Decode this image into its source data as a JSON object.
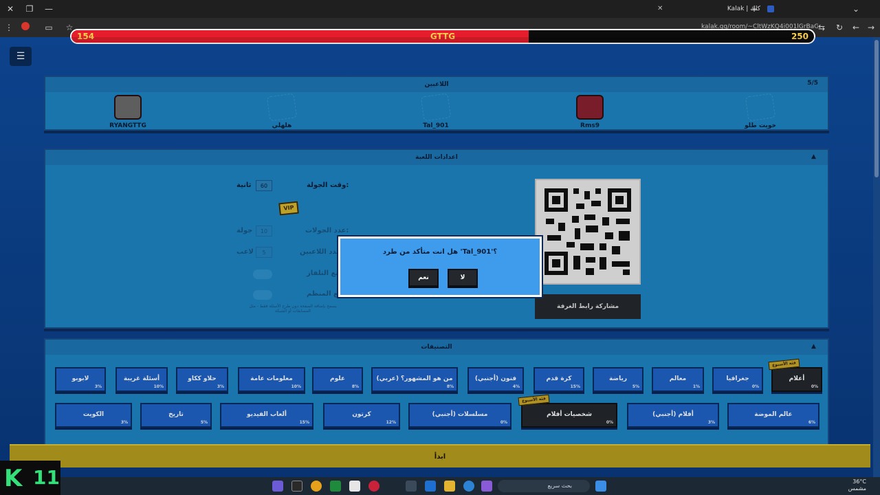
{
  "browser": {
    "tab_title": "Kalak | كلك",
    "url": "kalak.gg/room/~CltWzKQ4i001lGrBaGa-v3e"
  },
  "progress": {
    "left_value": "154",
    "center_label": "GTTG",
    "right_value": "250",
    "fill_fraction": 0.616
  },
  "players": {
    "title": "اللاعبين",
    "count": "5/5",
    "list": [
      {
        "name": "RYANGTTG",
        "has_avatar": true
      },
      {
        "name": "هلهلي",
        "has_avatar": false
      },
      {
        "name": "Tal_901",
        "has_avatar": false
      },
      {
        "name": "Rms9",
        "has_avatar": true
      },
      {
        "name": "خويت طلو",
        "has_avatar": false
      }
    ]
  },
  "settings": {
    "title": "اعدادات اللعبة",
    "round_time_label": "وقت الجولة:",
    "round_time_value": "60",
    "round_time_unit": "ثانية",
    "vip_label": "VIP",
    "rounds_label": "عدد الجولات:",
    "rounds_value": "10",
    "rounds_unit": "جولة",
    "players_label": "عدد اللاعبين:",
    "players_value": "5",
    "players_unit": "لاعب",
    "tv_mode_label": "ضع التلفاز:",
    "organizer_mode_label": "ضع المنظم:",
    "note": "يسمح بإضافة الصفحة دون طرح الأسئلة فقط - مثل المسابقات أو الشبكة",
    "share_button": "مشاركة رابط الغرفة"
  },
  "categories": {
    "title": "التصنيفات",
    "row1": [
      {
        "label": "لابوبو",
        "pct": "3%"
      },
      {
        "label": "أسئلة غريبة",
        "pct": "10%"
      },
      {
        "label": "حلاو ككاو",
        "pct": "3%"
      },
      {
        "label": "معلومات عامة",
        "pct": "10%"
      },
      {
        "label": "علوم",
        "pct": "8%"
      },
      {
        "label": "من هو المشهور؟ (عربي)",
        "pct": "8%"
      },
      {
        "label": "فنون (أجنبي)",
        "pct": "4%"
      },
      {
        "label": "كرة قدم",
        "pct": "15%"
      },
      {
        "label": "رياضة",
        "pct": "5%"
      },
      {
        "label": "معالم",
        "pct": "1%"
      },
      {
        "label": "جغرافيا",
        "pct": "0%"
      },
      {
        "label": "أعلام",
        "pct": "0%",
        "badge": "فئة الأسبوع"
      }
    ],
    "row2": [
      {
        "label": "الكويت",
        "pct": "3%"
      },
      {
        "label": "تاريخ",
        "pct": "5%"
      },
      {
        "label": "ألعاب الفيديو",
        "pct": "15%"
      },
      {
        "label": "كرتون",
        "pct": "12%"
      },
      {
        "label": "مسلسلات (أجنبي)",
        "pct": "0%"
      },
      {
        "label": "شخصيات أفلام",
        "pct": "0%",
        "badge": "فئة الأسبوع"
      },
      {
        "label": "أفلام (أجنبي)",
        "pct": "3%"
      },
      {
        "label": "عالم الموضة",
        "pct": "6%"
      }
    ]
  },
  "bottom_bar": {
    "label": "ابدأ"
  },
  "dialog": {
    "message": "هل انت متأكد من طرد 'Tal_901'؟",
    "yes_label": "نعم",
    "no_label": "لا"
  },
  "taskbar": {
    "search_placeholder": "بحث سريع",
    "temperature": "36°C",
    "weather": "مشمس"
  },
  "colors": {
    "page_bg": "#0d3f86",
    "panel_bg": "#1f86c5",
    "category_bg": "#1f63c8",
    "progress_fill": "#e51d2d",
    "gold": "#b8a01f",
    "dialog_bg": "#3f9cec"
  }
}
